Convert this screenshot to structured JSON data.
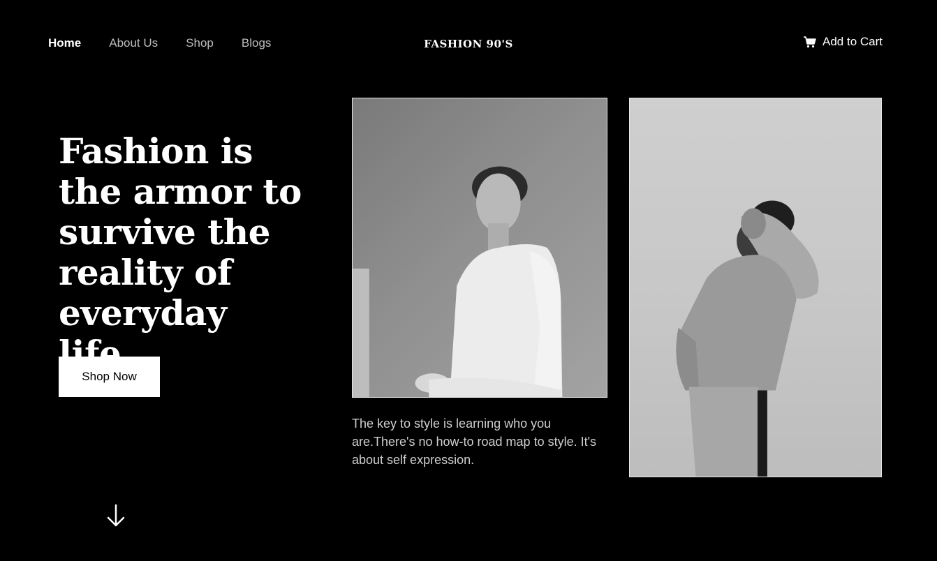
{
  "nav": {
    "links": [
      {
        "label": "Home",
        "active": true
      },
      {
        "label": "About Us",
        "active": false
      },
      {
        "label": "Shop",
        "active": false
      },
      {
        "label": "Blogs",
        "active": false
      }
    ],
    "brand": "FASHION 90'S",
    "cart_label": "Add to Cart",
    "cart_icon": "cart-icon"
  },
  "hero": {
    "title": "Fashion is the armor to survive the reality of everyday life.",
    "cta_label": "Shop Now",
    "scroll_icon": "arrow-down-icon"
  },
  "gallery": {
    "quote": "The key to style is learning who you are.There's no how-to road map to style. It's about self expression.",
    "images": [
      {
        "name": "woman-photo",
        "icon": "photo"
      },
      {
        "name": "man-photo",
        "icon": "photo"
      }
    ]
  },
  "colors": {
    "background": "#000000",
    "text": "#ffffff",
    "muted_text": "#bdbdbd",
    "button_bg": "#ffffff",
    "button_text": "#000000"
  }
}
